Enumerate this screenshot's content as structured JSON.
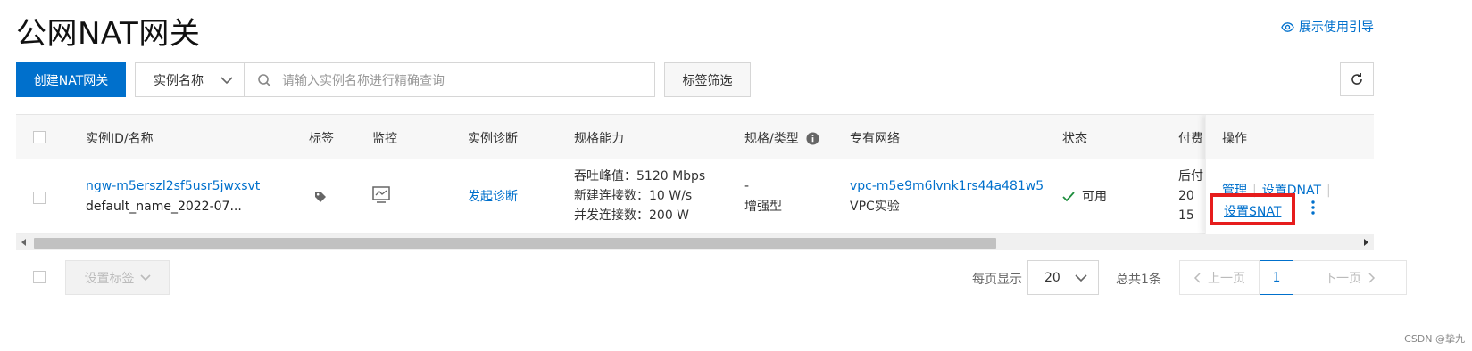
{
  "header": {
    "title": "公网NAT网关",
    "guide_link": "展示使用引导"
  },
  "toolbar": {
    "create_button": "创建NAT网关",
    "search_type": "实例名称",
    "search_placeholder": "请输入实例名称进行精确查询",
    "tag_filter_button": "标签筛选"
  },
  "table": {
    "columns": [
      "实例ID/名称",
      "标签",
      "监控",
      "实例诊断",
      "规格能力",
      "规格/类型",
      "专有网络",
      "状态",
      "付费",
      "操作"
    ],
    "rows": [
      {
        "instance_id": "ngw-m5erszl2sf5usr5jwxsvt",
        "instance_name": "default_name_2022-07...",
        "diagnose_link": "发起诊断",
        "spec_throughput": "吞吐峰值：5120 Mbps",
        "spec_new_conn": "新建连接数：10 W/s",
        "spec_concurrent": "并发连接数：200 W",
        "spec_dash": "-",
        "spec_type": "增强型",
        "vpc_id": "vpc-m5e9m6lvnk1rs44a481w5",
        "vpc_name": "VPC实验",
        "status": "可用",
        "billing_line1": "后付",
        "billing_line2": "20",
        "billing_line3": "15",
        "actions": {
          "manage": "管理",
          "set_dnat": "设置DNAT",
          "set_snat": "设置SNAT"
        }
      }
    ]
  },
  "footer": {
    "set_tag_button": "设置标签",
    "page_size_label": "每页显示",
    "page_size": "20",
    "total": "总共1条",
    "prev": "上一页",
    "current_page": "1",
    "next": "下一页"
  },
  "watermark": "CSDN @挚九",
  "colors": {
    "primary": "#0070cc",
    "success": "#1e8e3e",
    "highlight_box": "#e61d1d"
  }
}
